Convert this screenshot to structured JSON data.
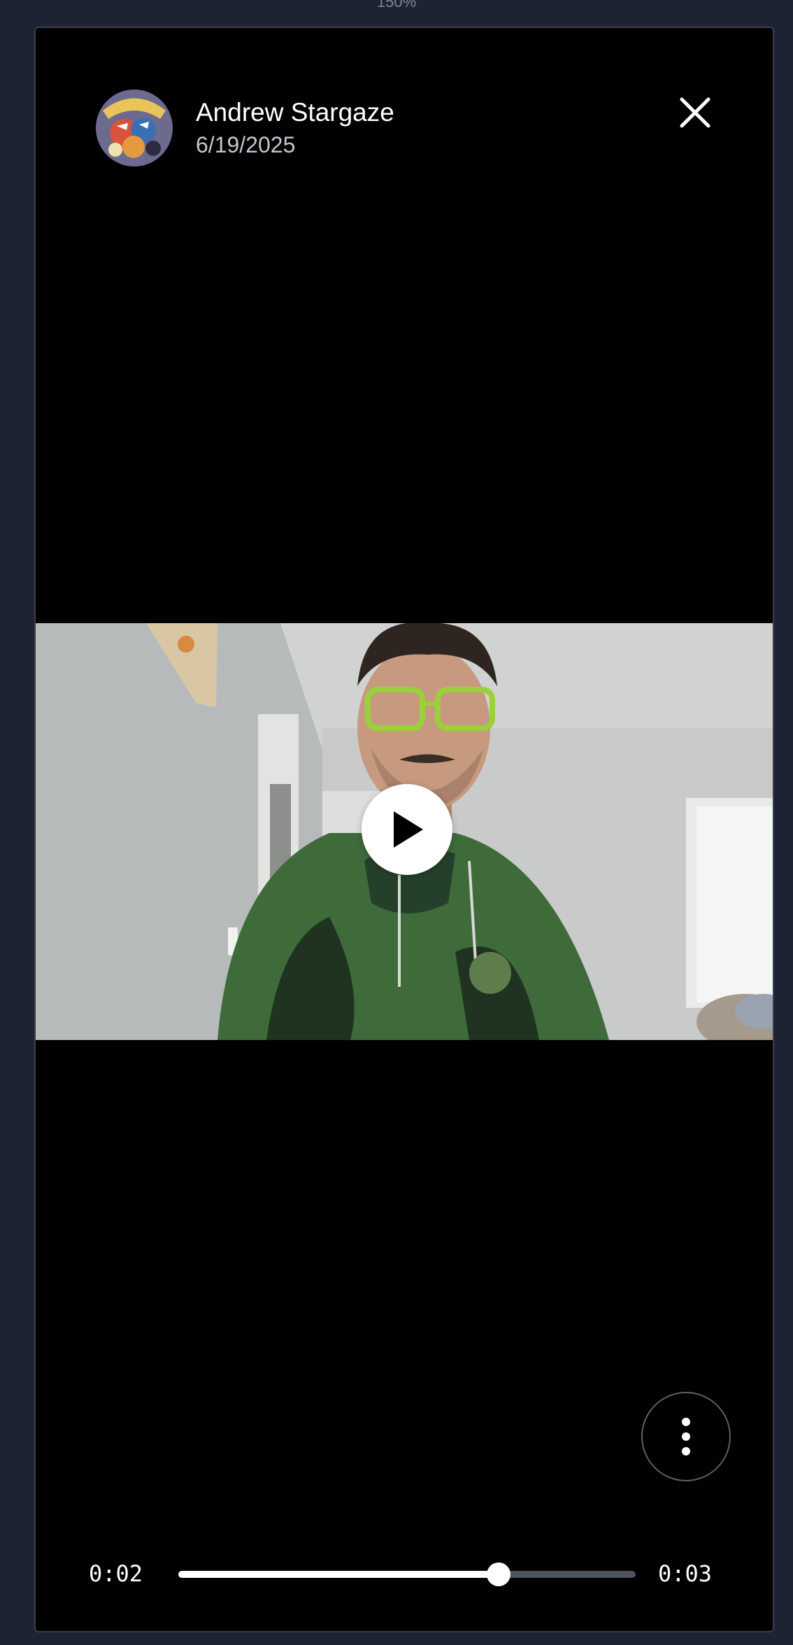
{
  "zoom_label": "150%",
  "post": {
    "author_name": "Andrew Stargaze",
    "date": "6/19/2025"
  },
  "player": {
    "current_time": "0:02",
    "total_time": "0:03",
    "progress": 0.7,
    "state": "paused"
  },
  "icons": {
    "close": "close-icon",
    "play": "play-icon",
    "more": "more-vertical-icon"
  },
  "colors": {
    "page_background": "#1e2333",
    "viewer_background": "#000000",
    "track": "#4d525d",
    "track_fill": "#ffffff"
  }
}
